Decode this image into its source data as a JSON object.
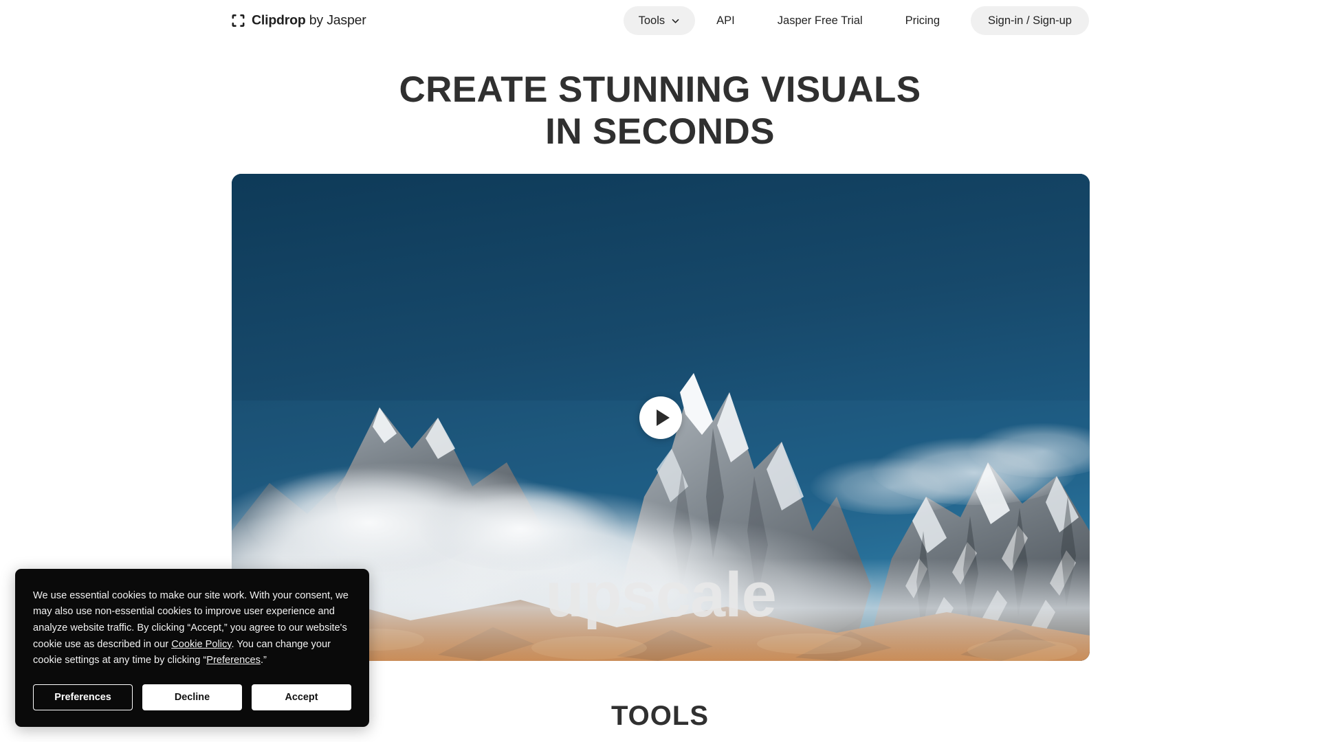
{
  "header": {
    "brand": {
      "icon": "crop-frame-icon",
      "name": "Clipdrop",
      "suffix": " by Jasper"
    },
    "nav": {
      "tools_label": "Tools",
      "tools_chevron": "chevron-down-icon",
      "api_label": "API",
      "jasper_trial_label": "Jasper Free Trial",
      "pricing_label": "Pricing",
      "signin_label": "Sign-in / Sign-up"
    }
  },
  "hero": {
    "title_line1": "CREATE STUNNING VISUALS",
    "title_line2": "IN SECONDS"
  },
  "video": {
    "caption": "upscale",
    "play_icon": "play-icon",
    "scene": "snow-capped-mountain-peaks-with-clouds"
  },
  "tools_section": {
    "heading": "TOOLS"
  },
  "cookie_banner": {
    "text_part1": "We use essential cookies to make our site work. With your consent, we may also use non-essential cookies to improve user experience and analyze website traffic. By clicking “Accept,” you agree to our website's cookie use as described in our ",
    "cookie_policy_link": "Cookie Policy",
    "text_part2": ". You can change your cookie settings at any time by clicking “",
    "preferences_link": "Preferences",
    "text_part3": ".”",
    "preferences_button": "Preferences",
    "decline_button": "Decline",
    "accept_button": "Accept"
  },
  "colors": {
    "page_background": "#ffffff",
    "text_dark": "#303030",
    "nav_pill_background": "#f0f0f0",
    "banner_background": "#0a0a0a",
    "sky_blue": "#164464",
    "terrain_orange": "#b4662f",
    "caption_grey": "#e8e8e8"
  }
}
